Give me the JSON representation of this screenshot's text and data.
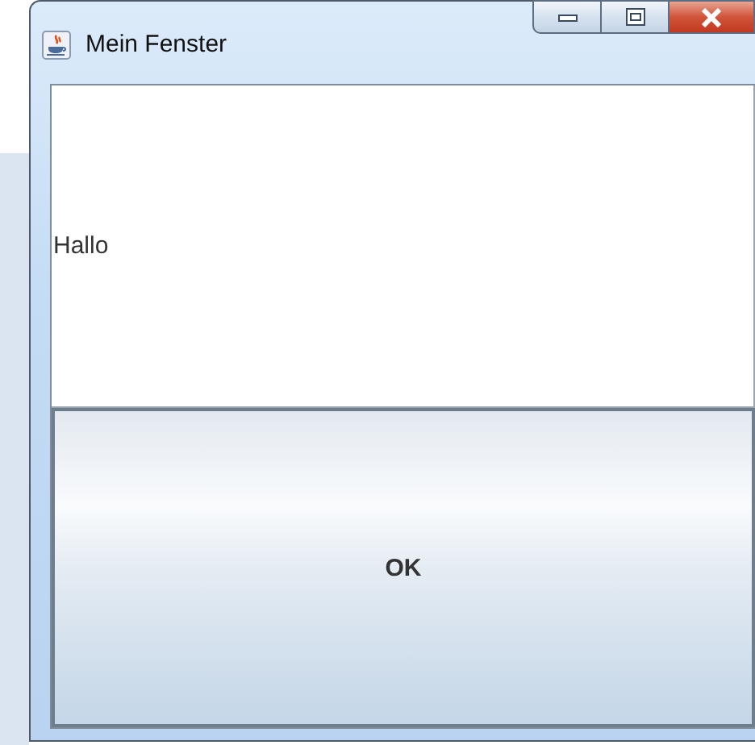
{
  "window": {
    "title": "Mein Fenster"
  },
  "label": {
    "text": "Hallo"
  },
  "button": {
    "label": "OK"
  }
}
